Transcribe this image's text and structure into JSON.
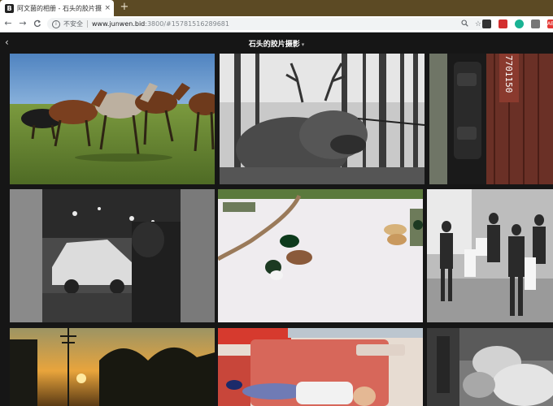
{
  "browser": {
    "tab": {
      "favicon": "B",
      "title": "阿文菌的相册 - 石头的胶片摄影",
      "close": "×"
    },
    "new_tab": "+",
    "nav": {
      "back": "←",
      "forward": "→",
      "reload": "C"
    },
    "address": {
      "security_label": "不安全",
      "host": "www.junwen.bid",
      "path": ":3800/#15781516289681"
    },
    "extensions": [
      {
        "icon": "ext-dark-icon",
        "text": "",
        "color": "#333333"
      },
      {
        "icon": "ext-red-icon",
        "text": "",
        "color": "#d32f2f"
      },
      {
        "icon": "ext-green-icon",
        "text": "",
        "color": "#1ab394"
      },
      {
        "icon": "ext-gray-icon",
        "text": "",
        "color": "#777777"
      },
      {
        "icon": "ext-abp-icon",
        "text": "ABP",
        "color": "#e53935"
      }
    ]
  },
  "app": {
    "back": "‹",
    "album_title": "石头的胶片摄影",
    "album_caret": "▾"
  },
  "photos": [
    {
      "name": "photo-horses",
      "subject": "horses"
    },
    {
      "name": "photo-reindeer",
      "subject": "reindeer"
    },
    {
      "name": "photo-train-door",
      "subject": "train"
    },
    {
      "name": "photo-car-night",
      "subject": "car"
    },
    {
      "name": "photo-dogs-snow",
      "subject": "dogs"
    },
    {
      "name": "photo-dancers",
      "subject": "dancers"
    },
    {
      "name": "photo-sunset",
      "subject": "sunset"
    },
    {
      "name": "photo-child-sleeping",
      "subject": "child"
    },
    {
      "name": "photo-bw-sleeping",
      "subject": "sleeping"
    }
  ],
  "colors": {
    "tabstrip": "#5c4a24",
    "page_bg": "#161616"
  }
}
